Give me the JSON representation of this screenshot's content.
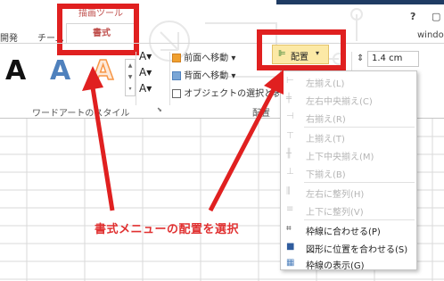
{
  "ribbon": {
    "tabs": [
      "開発",
      "チーム"
    ],
    "contextual_group": "描画ツール",
    "active_tab": "書式",
    "window_menu": "window",
    "help": "?",
    "wordart_styles_label": "ワードアートのスタイル",
    "wordart_samples": [
      "A",
      "A",
      "A"
    ],
    "arrange": {
      "bring_forward": "前面へ移動",
      "send_backward": "背面へ移動",
      "selection_pane": "オブジェクトの選択と表示",
      "align_button": "配置",
      "group_label": "配置"
    },
    "size_value": "1.4 cm"
  },
  "align_menu": {
    "items": [
      {
        "label": "左揃え(L)",
        "enabled": false,
        "icon": "align-left-icon"
      },
      {
        "label": "左右中央揃え(C)",
        "enabled": false,
        "icon": "align-center-icon"
      },
      {
        "label": "右揃え(R)",
        "enabled": false,
        "icon": "align-right-icon"
      },
      {
        "label": "上揃え(T)",
        "enabled": false,
        "icon": "align-top-icon"
      },
      {
        "label": "上下中央揃え(M)",
        "enabled": false,
        "icon": "align-middle-icon"
      },
      {
        "label": "下揃え(B)",
        "enabled": false,
        "icon": "align-bottom-icon"
      },
      {
        "label": "左右に整列(H)",
        "enabled": false,
        "icon": "distribute-horizontal-icon"
      },
      {
        "label": "上下に整列(V)",
        "enabled": false,
        "icon": "distribute-vertical-icon"
      },
      {
        "label": "枠線に合わせる(P)",
        "enabled": true,
        "icon": "snap-to-grid-icon"
      },
      {
        "label": "図形に位置を合わせる(S)",
        "enabled": true,
        "icon": "snap-to-shape-icon"
      },
      {
        "label": "枠線の表示(G)",
        "enabled": true,
        "icon": "view-gridlines-icon"
      }
    ]
  },
  "annotation": {
    "text": "書式メニューの配置を選択",
    "color": "#e03030"
  },
  "colors": {
    "highlight": "#e02020",
    "contextual_tab": "#c0504d",
    "wordart_blue": "#4f81bd",
    "wordart_orange": "#f79646"
  }
}
